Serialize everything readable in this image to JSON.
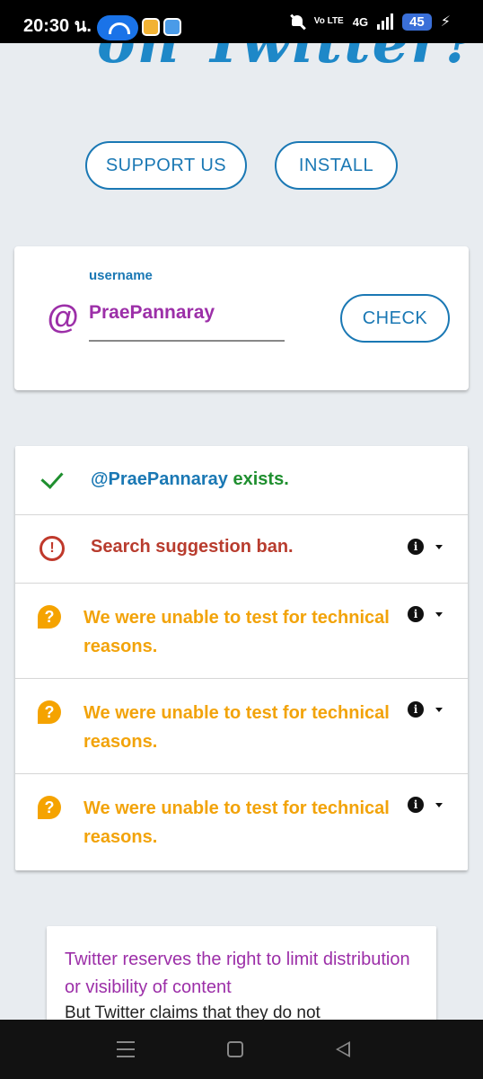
{
  "status_bar": {
    "time": "20:30 น.",
    "volte": "Vo LTE",
    "network": "4G",
    "battery": "45"
  },
  "header": {
    "title_partial": "on Twitter?"
  },
  "actions": {
    "support_label": "SUPPORT US",
    "install_label": "INSTALL"
  },
  "username_form": {
    "at_symbol": "@",
    "label": "username",
    "value": "PraePannaray",
    "check_label": "CHECK"
  },
  "results": {
    "exists": {
      "user": "@PraePannaray",
      "status": "exists.",
      "icon": "checkmark-icon",
      "color": "#1f8f2f"
    },
    "ban": {
      "text": "Search suggestion ban.",
      "icon": "alert-circle-icon",
      "color": "#b83c2e"
    },
    "unable": [
      {
        "text": "We were unable to test for technical reasons.",
        "icon": "question-bubble-icon",
        "color": "#f2a30a"
      },
      {
        "text": "We were unable to test for technical reasons.",
        "icon": "question-bubble-icon",
        "color": "#f2a30a"
      },
      {
        "text": "We were unable to test for technical reasons.",
        "icon": "question-bubble-icon",
        "color": "#f2a30a"
      }
    ]
  },
  "info_card": {
    "heading": "Twitter reserves the right to limit distribution or visibility of content",
    "sub_partial": "But Twitter claims that they do not"
  },
  "colors": {
    "accent_blue": "#1a78b4",
    "accent_purple": "#9c2fa8",
    "background": "#e8ecf0"
  }
}
